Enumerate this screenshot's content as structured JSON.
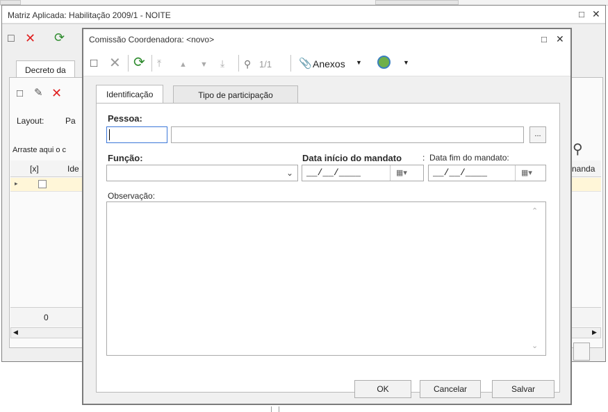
{
  "outer_window": {
    "title": "Matriz Aplicada: Habilitação 2009/1 - NOITE",
    "tab_label": "Decreto da",
    "layout_label": "Layout:",
    "layout_value": "Pa",
    "drag_hint": "Arraste aqui o c",
    "col_x": "[x]",
    "col_ident": "Ide",
    "col_right": "nanda",
    "footer_count": "0"
  },
  "dialog": {
    "title": "Comissão Coordenadora: <novo>",
    "record_counter": "1/1",
    "anexos_label": "Anexos",
    "tabs": [
      "Identificação",
      "Tipo de participação"
    ],
    "pessoa_label": "Pessoa:",
    "pessoa_code": "",
    "pessoa_name": "",
    "lookup_button": "...",
    "funcao_label": "Função:",
    "funcao_value": "",
    "data_inicio_label": "Data início do mandato",
    "data_inicio_colon": ":",
    "data_inicio_value": "__/__/____",
    "data_fim_label": "Data fim do mandato:",
    "data_fim_value": "__/__/____",
    "observacao_label": "Observação:",
    "observacao_value": "",
    "buttons": {
      "ok": "OK",
      "cancel": "Cancelar",
      "save": "Salvar"
    }
  },
  "colors": {
    "delete_red": "#e02020",
    "refresh_green": "#2e8b2e",
    "focus_blue": "#3b77d8",
    "selected_row": "#fff6d8"
  },
  "icons": [
    "new-icon",
    "delete-icon",
    "refresh-icon",
    "first-icon",
    "prev-icon",
    "next-icon",
    "last-icon",
    "search-icon",
    "attachment-icon",
    "globe-icon",
    "maximize-icon",
    "close-icon",
    "calendar-icon",
    "chevron-down-icon",
    "scroll-up-icon",
    "scroll-down-icon"
  ]
}
